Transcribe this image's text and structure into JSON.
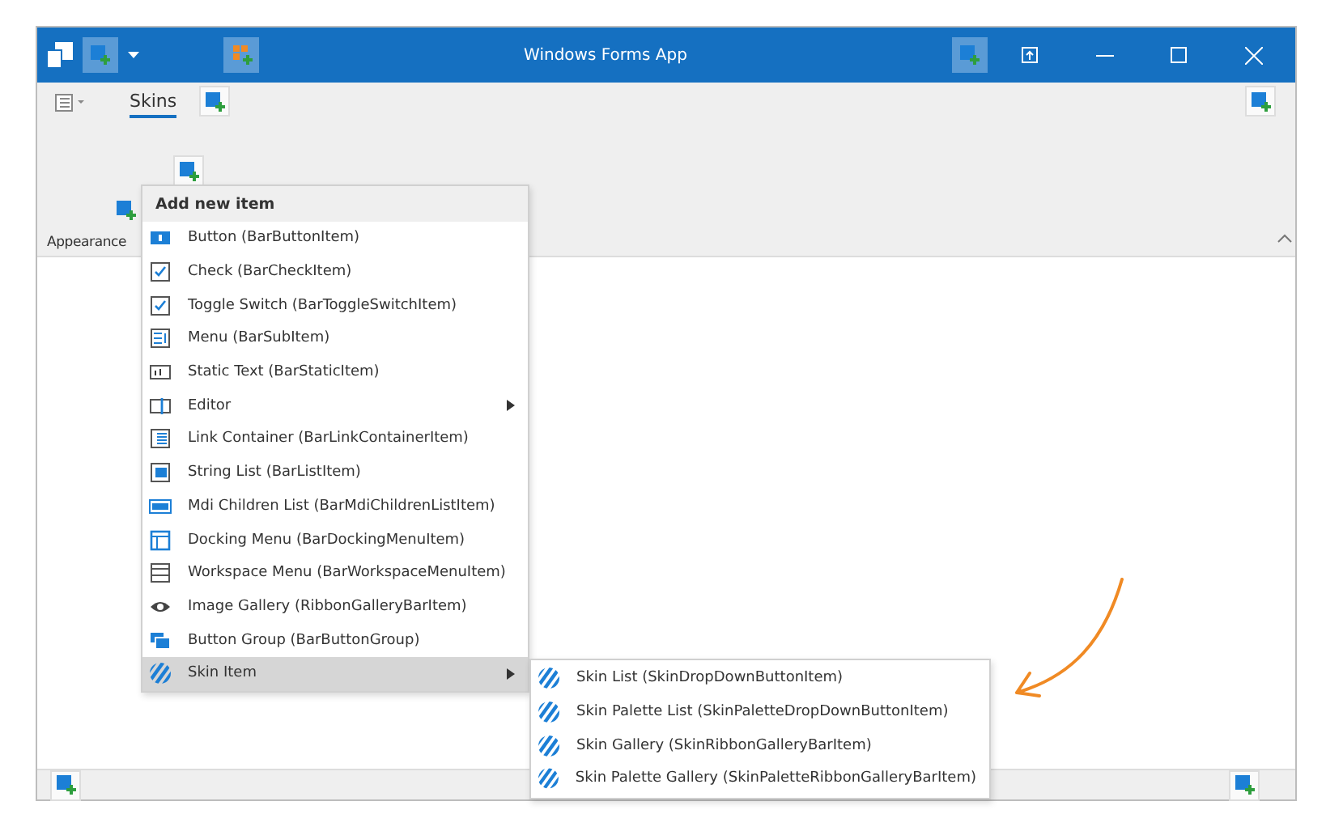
{
  "window": {
    "title": "Windows Forms App"
  },
  "ribbon": {
    "tabs": [
      {
        "label": "Skins",
        "selected": true
      }
    ],
    "group_label": "Appearance"
  },
  "menu": {
    "header": "Add new item",
    "items": [
      {
        "label": "Button (BarButtonItem)",
        "submenu": false,
        "selected": false
      },
      {
        "label": "Check (BarCheckItem)",
        "submenu": false,
        "selected": false
      },
      {
        "label": "Toggle Switch (BarToggleSwitchItem)",
        "submenu": false,
        "selected": false
      },
      {
        "label": "Menu (BarSubItem)",
        "submenu": false,
        "selected": false
      },
      {
        "label": "Static Text (BarStaticItem)",
        "submenu": false,
        "selected": false
      },
      {
        "label": "Editor",
        "submenu": true,
        "selected": false
      },
      {
        "label": "Link Container (BarLinkContainerItem)",
        "submenu": false,
        "selected": false
      },
      {
        "label": "String List (BarListItem)",
        "submenu": false,
        "selected": false
      },
      {
        "label": "Mdi Children List (BarMdiChildrenListItem)",
        "submenu": false,
        "selected": false
      },
      {
        "label": "Docking Menu (BarDockingMenuItem)",
        "submenu": false,
        "selected": false
      },
      {
        "label": "Workspace Menu (BarWorkspaceMenuItem)",
        "submenu": false,
        "selected": false
      },
      {
        "label": "Image Gallery (RibbonGalleryBarItem)",
        "submenu": false,
        "selected": false
      },
      {
        "label": "Button Group (BarButtonGroup)",
        "submenu": false,
        "selected": false
      },
      {
        "label": "Skin Item",
        "submenu": true,
        "selected": true
      }
    ]
  },
  "submenu": {
    "items": [
      {
        "label": "Skin List (SkinDropDownButtonItem)"
      },
      {
        "label": "Skin Palette List (SkinPaletteDropDownButtonItem)"
      },
      {
        "label": "Skin Gallery (SkinRibbonGalleryBarItem)"
      },
      {
        "label": "Skin Palette Gallery (SkinPaletteRibbonGalleryBarItem)"
      }
    ]
  }
}
